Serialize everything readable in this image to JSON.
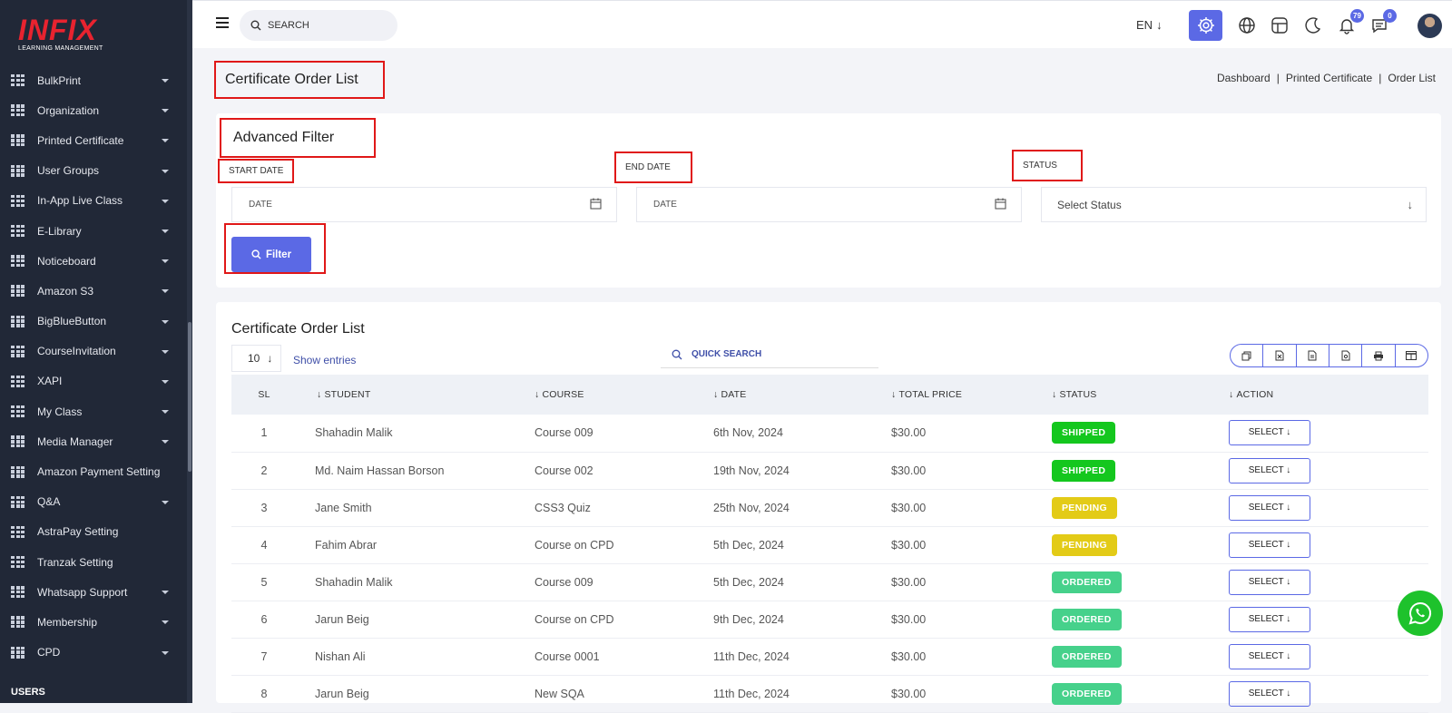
{
  "brand": {
    "logo": "INFIX",
    "tagline": "LEARNING MANAGEMENT"
  },
  "sidebar": {
    "items": [
      {
        "label": "BulkPrint",
        "caret": true
      },
      {
        "label": "Organization",
        "caret": true
      },
      {
        "label": "Printed Certificate",
        "caret": true
      },
      {
        "label": "User Groups",
        "caret": true
      },
      {
        "label": "In-App Live Class",
        "caret": true
      },
      {
        "label": "E-Library",
        "caret": true
      },
      {
        "label": "Noticeboard",
        "caret": true
      },
      {
        "label": "Amazon S3",
        "caret": true
      },
      {
        "label": "BigBlueButton",
        "caret": true
      },
      {
        "label": "CourseInvitation",
        "caret": true
      },
      {
        "label": "XAPI",
        "caret": true
      },
      {
        "label": "My Class",
        "caret": true
      },
      {
        "label": "Media Manager",
        "caret": true
      },
      {
        "label": "Amazon Payment Setting",
        "caret": false
      },
      {
        "label": "Q&A",
        "caret": true
      },
      {
        "label": "AstraPay Setting",
        "caret": false
      },
      {
        "label": "Tranzak Setting",
        "caret": false
      },
      {
        "label": "Whatsapp Support",
        "caret": true
      },
      {
        "label": "Membership",
        "caret": true
      },
      {
        "label": "CPD",
        "caret": true
      }
    ],
    "section_heading": "USERS"
  },
  "topbar": {
    "search_placeholder": "SEARCH",
    "language": "EN",
    "notifications_count": "79",
    "messages_count": "0"
  },
  "page": {
    "title": "Certificate Order List",
    "breadcrumb": [
      "Dashboard",
      "Printed Certificate",
      "Order List"
    ]
  },
  "filter": {
    "heading": "Advanced Filter",
    "start_date_label": "START DATE",
    "end_date_label": "END DATE",
    "status_label": "STATUS",
    "date_placeholder": "DATE",
    "status_placeholder": "Select Status",
    "button_label": "Filter"
  },
  "list": {
    "heading": "Certificate Order List",
    "entries_value": "10",
    "show_entries": "Show entries",
    "quick_search": "QUICK SEARCH",
    "columns": [
      "SL",
      "STUDENT",
      "COURSE",
      "DATE",
      "TOTAL PRICE",
      "STATUS",
      "ACTION"
    ],
    "action_label": "SELECT",
    "rows": [
      {
        "sl": "1",
        "student": "Shahadin Malik",
        "course": "Course 009",
        "date": "6th Nov, 2024",
        "price": "$30.00",
        "status": "SHIPPED",
        "status_key": "shipped"
      },
      {
        "sl": "2",
        "student": "Md. Naim Hassan Borson",
        "course": "Course 002",
        "date": "19th Nov, 2024",
        "price": "$30.00",
        "status": "SHIPPED",
        "status_key": "shipped"
      },
      {
        "sl": "3",
        "student": "Jane Smith",
        "course": "CSS3 Quiz",
        "date": "25th Nov, 2024",
        "price": "$30.00",
        "status": "PENDING",
        "status_key": "pending"
      },
      {
        "sl": "4",
        "student": "Fahim Abrar",
        "course": "Course on CPD",
        "date": "5th Dec, 2024",
        "price": "$30.00",
        "status": "PENDING",
        "status_key": "pending"
      },
      {
        "sl": "5",
        "student": "Shahadin Malik",
        "course": "Course 009",
        "date": "5th Dec, 2024",
        "price": "$30.00",
        "status": "ORDERED",
        "status_key": "ordered"
      },
      {
        "sl": "6",
        "student": "Jarun Beig",
        "course": "Course on CPD",
        "date": "9th Dec, 2024",
        "price": "$30.00",
        "status": "ORDERED",
        "status_key": "ordered"
      },
      {
        "sl": "7",
        "student": "Nishan Ali",
        "course": "Course 0001",
        "date": "11th Dec, 2024",
        "price": "$30.00",
        "status": "ORDERED",
        "status_key": "ordered"
      },
      {
        "sl": "8",
        "student": "Jarun Beig",
        "course": "New SQA",
        "date": "11th Dec, 2024",
        "price": "$30.00",
        "status": "ORDERED",
        "status_key": "ordered"
      }
    ]
  },
  "colors": {
    "accent": "#5b69e5",
    "sidebar_bg": "#212837",
    "shipped": "#14c71e",
    "pending": "#e3cb17",
    "ordered": "#46d18b",
    "highlight": "#e01818",
    "whatsapp": "#1ec22c"
  }
}
